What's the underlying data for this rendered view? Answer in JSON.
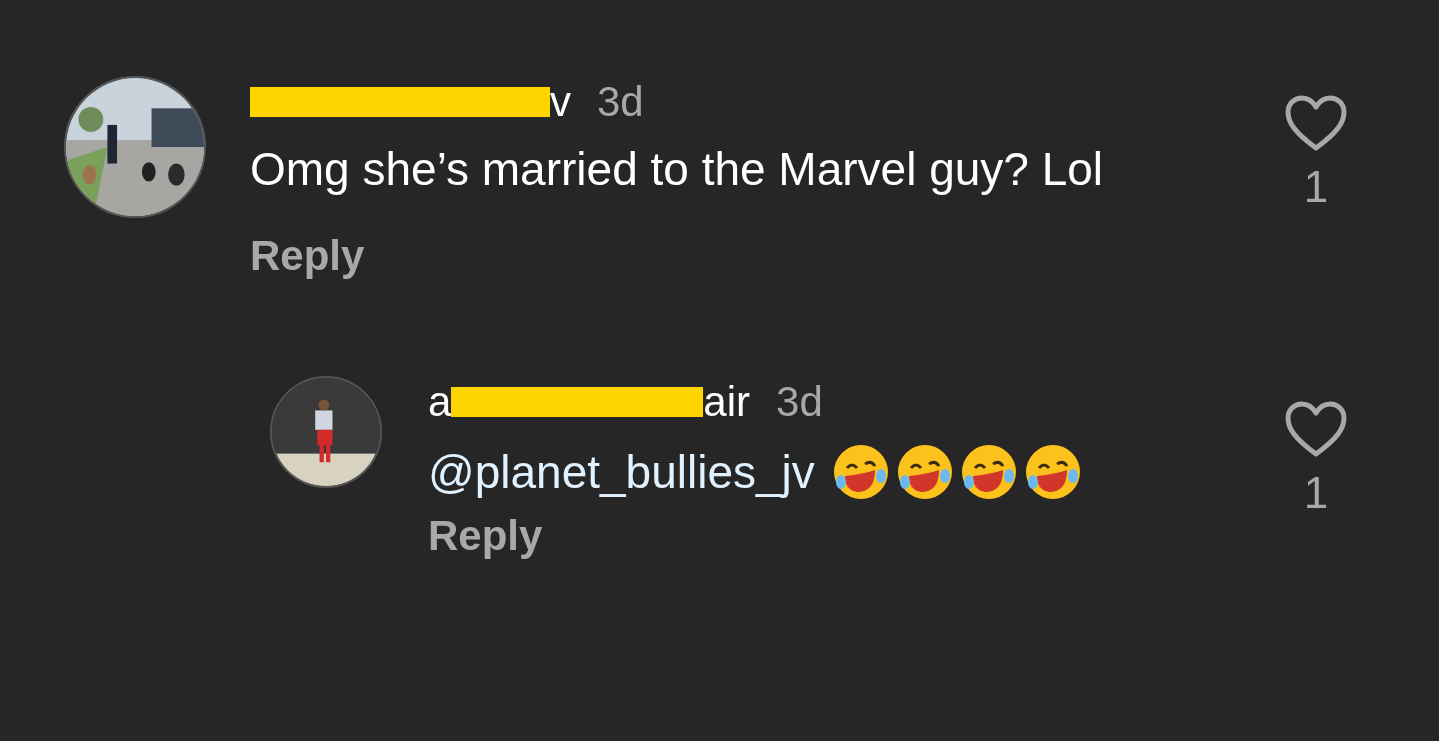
{
  "comments": [
    {
      "avatar": {
        "kind": "picture"
      },
      "username": [
        {
          "kind": "redaction"
        },
        {
          "kind": "text",
          "text": "v"
        }
      ],
      "time": "3d",
      "text": "Omg she’s married to the Marvel guy? Lol",
      "reply": "Reply",
      "liked": false,
      "likes": "1",
      "children": [
        {
          "avatar": {
            "kind": "picture"
          },
          "username": [
            {
              "kind": "text",
              "text": "a"
            },
            {
              "kind": "redaction"
            },
            {
              "kind": "text",
              "text": "air"
            }
          ],
          "time": "3d",
          "mention": "@planet_bullies_jv",
          "emojis": [
            {
              "kind": "laughing"
            },
            {
              "kind": "laughing"
            },
            {
              "kind": "laughing"
            },
            {
              "kind": "laughing"
            }
          ],
          "reply": "Reply",
          "liked": false,
          "likes": "1"
        }
      ]
    }
  ]
}
